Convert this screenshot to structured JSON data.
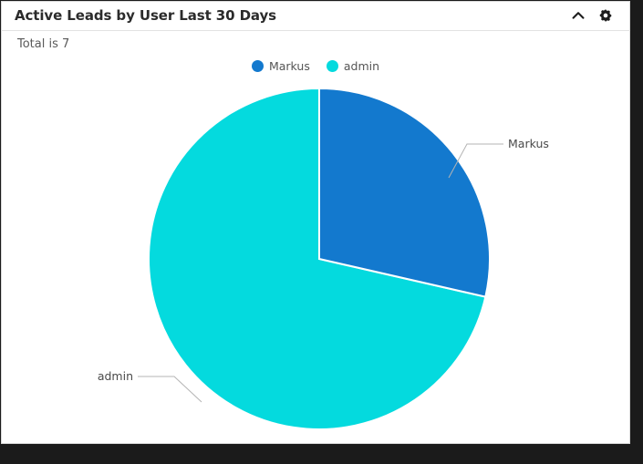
{
  "panel": {
    "title": "Active Leads by User Last 30 Days",
    "subtitle": "Total is 7",
    "collapse_icon": "chevron-up-icon",
    "settings_icon": "gear-icon"
  },
  "legend": {
    "position": "top-center",
    "items": [
      {
        "label": "Markus",
        "color": "#1379ce"
      },
      {
        "label": "admin",
        "color": "#04dade"
      }
    ]
  },
  "callouts": [
    {
      "label": "Markus",
      "color": "#1379ce"
    },
    {
      "label": "admin",
      "color": "#04dade"
    }
  ],
  "chart_data": {
    "type": "pie",
    "title": "Active Leads by User Last 30 Days",
    "subtitle": "Total is 7",
    "total": 7,
    "categories": [
      "Markus",
      "admin"
    ],
    "values": [
      2,
      5
    ],
    "percentages": [
      28.6,
      71.4
    ],
    "colors": [
      "#1379ce",
      "#04dade"
    ],
    "labels_shown": [
      "Markus",
      "admin"
    ],
    "legend": "top-center",
    "start_angle_deg": 0,
    "direction": "clockwise",
    "grid": false,
    "xlabel": "",
    "ylabel": ""
  },
  "colors": {
    "series_blue": "#1379ce",
    "series_cyan": "#04dade",
    "panel_border": "#1b1b1b",
    "divider": "#e2e2e2",
    "title_text": "#2b2b2b",
    "muted_text": "#5a5a5a",
    "callout_line": "#b4b4b4"
  }
}
